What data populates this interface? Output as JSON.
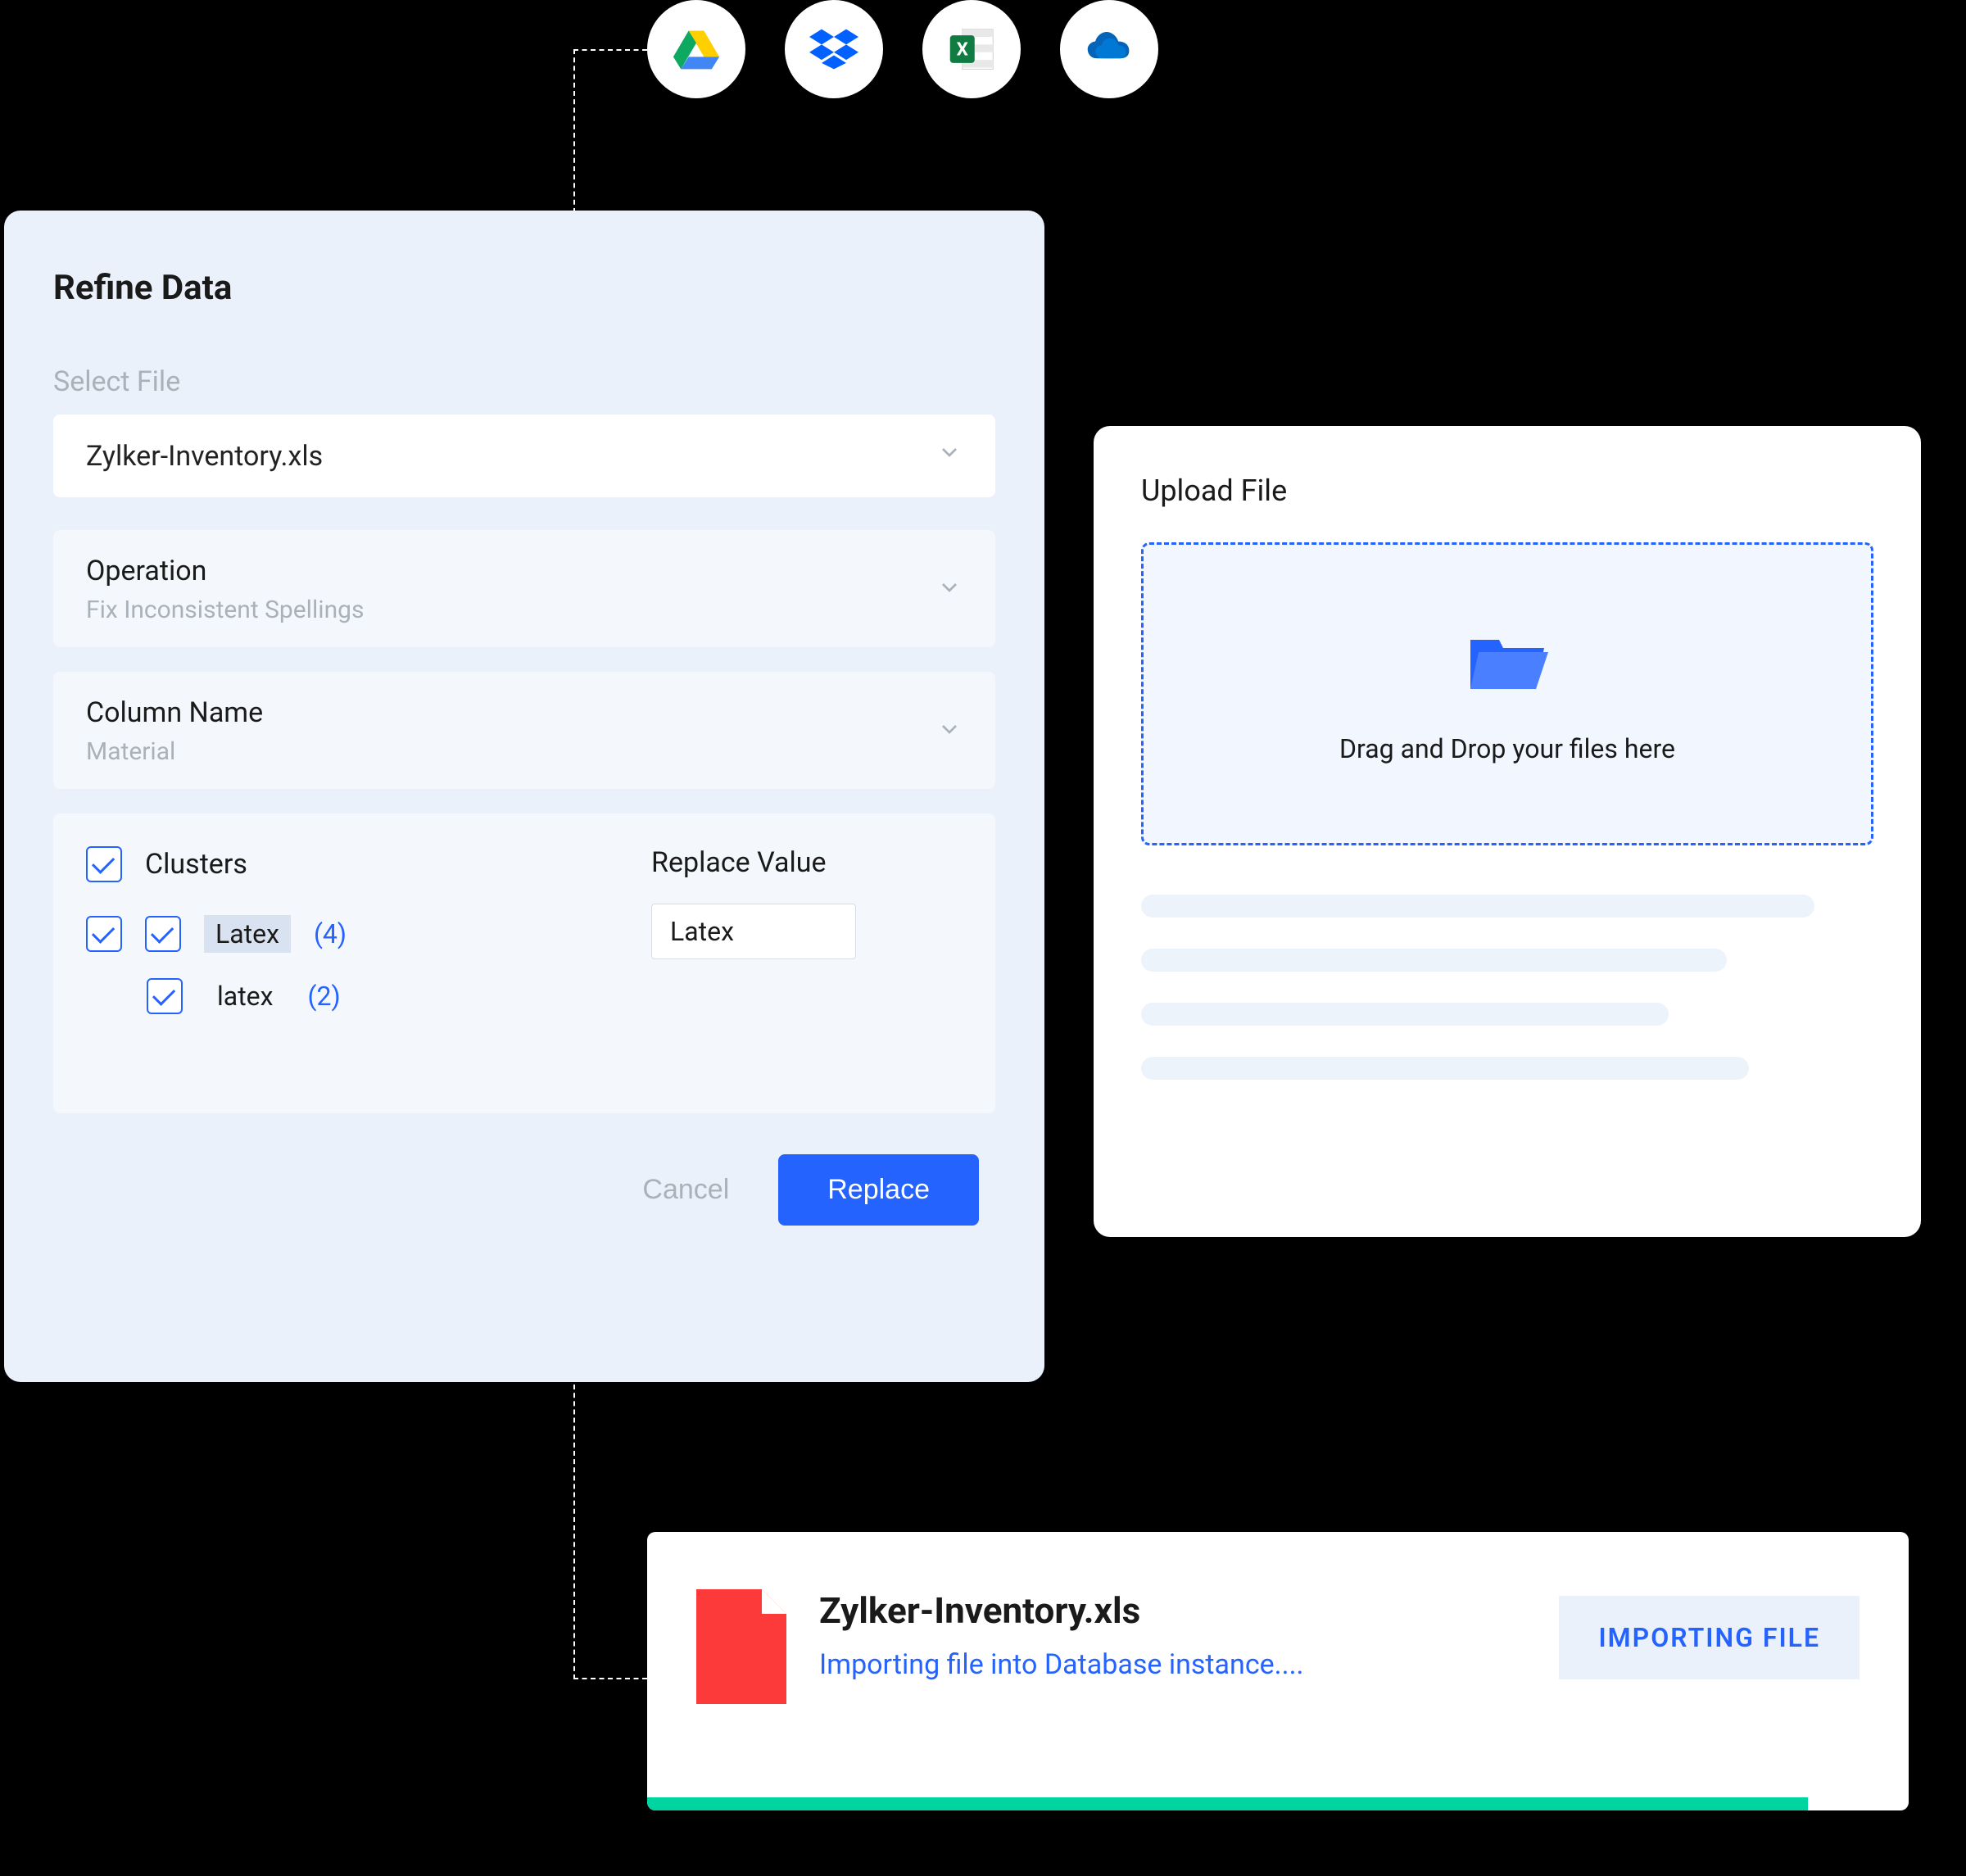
{
  "icons": {
    "drive": "google-drive",
    "dropbox": "dropbox",
    "excel": "excel",
    "onedrive": "onedrive"
  },
  "refine": {
    "title": "Refine Data",
    "select_file_label": "Select File",
    "selected_file": "Zylker-Inventory.xls",
    "operation": {
      "label": "Operation",
      "value": "Fix Inconsistent Spellings"
    },
    "column": {
      "label": "Column Name",
      "value": "Material"
    },
    "clusters": {
      "header": "Clusters",
      "replace_label": "Replace Value",
      "replace_value": "Latex",
      "items": [
        {
          "value": "Latex",
          "count": "(4)",
          "checked": true,
          "highlighted": true
        },
        {
          "value": "latex",
          "count": "(2)",
          "checked": true,
          "highlighted": false
        }
      ]
    },
    "buttons": {
      "cancel": "Cancel",
      "replace": "Replace"
    }
  },
  "upload": {
    "title": "Upload File",
    "dropzone_text": "Drag and Drop your files here"
  },
  "import": {
    "filename": "Zylker-Inventory.xls",
    "status": "Importing file into Database instance....",
    "badge": "IMPORTING FILE"
  }
}
